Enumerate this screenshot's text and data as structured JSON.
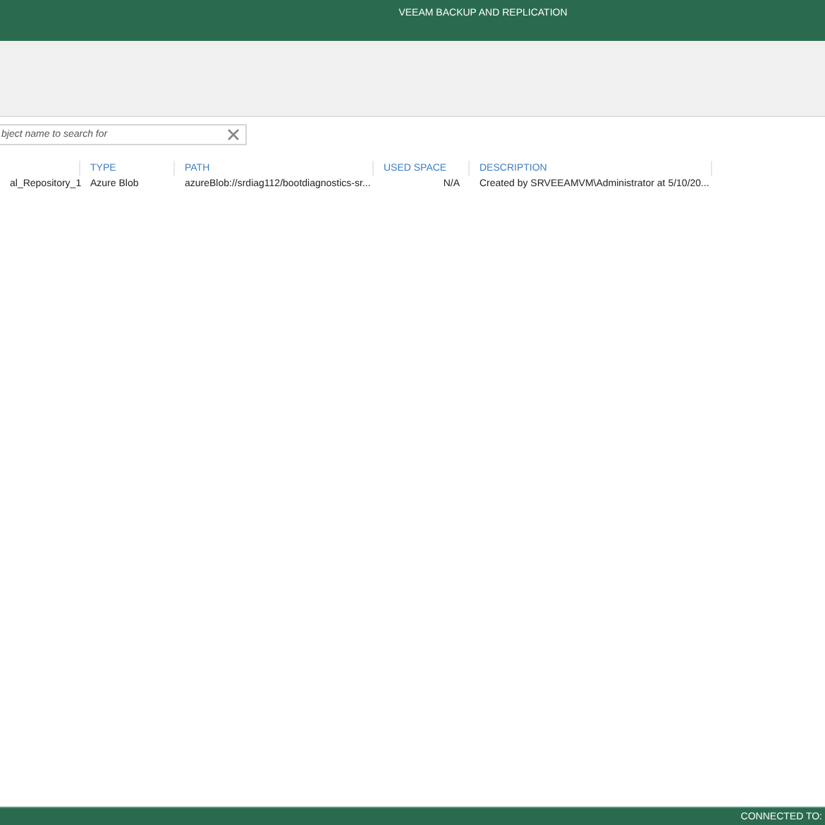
{
  "window": {
    "title": "VEEAM BACKUP AND REPLICATION"
  },
  "search": {
    "placeholder": "bject name to search for"
  },
  "table": {
    "columns": [
      "",
      "TYPE",
      "PATH",
      "USED SPACE",
      "DESCRIPTION"
    ],
    "rows": [
      [
        "al_Repository_1",
        "Azure Blob",
        "azureBlob://srdiag112/bootdiagnostics-sr...",
        "N/A",
        "Created by SRVEEAMVM\\Administrator at 5/10/20..."
      ]
    ]
  },
  "status_bar": {
    "text": "CONNECTED TO:"
  }
}
